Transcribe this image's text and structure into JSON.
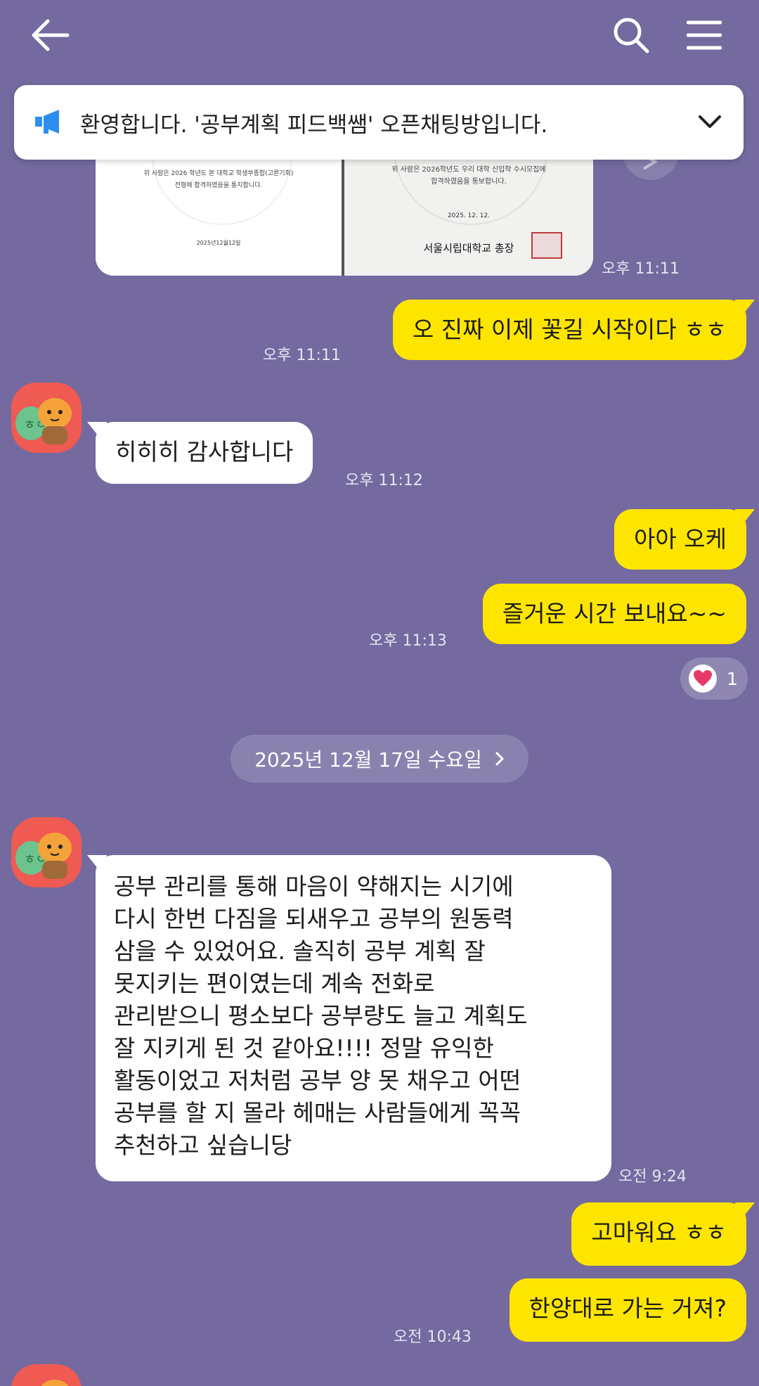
{
  "notice": {
    "text": "환영합니다. '공부계획  피드백쌤' 오픈채팅방입니다."
  },
  "shared_image": {
    "doc1_line1": "위 사람은 2026 학년도 본 대학교  학생부종합(고른기회)",
    "doc1_line2": "전형에 합격하였음을 통지합니다.",
    "doc1_date": "2025년12월12일",
    "doc2_line1": "위 사람은 2026학년도 우리 대학 신입학 수시모집에",
    "doc2_line2": "합격하였음을 통보합니다.",
    "doc2_date": "2025. 12. 12.",
    "doc2_sign": "서울시립대학교 총장",
    "time": "오후 11:11"
  },
  "messages": [
    {
      "sender": "me",
      "text": "오 진짜 이제 꽃길 시작이다 ㅎㅎ",
      "time": "오후 11:11"
    },
    {
      "sender": "other",
      "text": "히히히 감사합니다",
      "time": "오후 11:12"
    },
    {
      "sender": "me",
      "text": "아아 오케"
    },
    {
      "sender": "me",
      "text": "즐거운 시간 보내요~~",
      "time": "오후 11:13",
      "reaction_count": "1"
    },
    {
      "sender": "other",
      "lines": [
        "공부 관리를 통해 마음이 약해지는 시기에",
        "다시 한번 다짐을 되새우고 공부의 원동력",
        "삼을 수 있었어요. 솔직히 공부 계획 잘",
        "못지키는 편이였는데 계속 전화로",
        "관리받으니 평소보다 공부량도 늘고 계획도",
        "잘 지키게 된 것 같아요!!!! 정말 유익한",
        "활동이었고 저처럼 공부 양 못 채우고 어떤",
        "공부를 할 지 몰라 헤매는 사람들에게 꼭꼭",
        "추천하고 싶습니당"
      ],
      "time": "오전 9:24"
    },
    {
      "sender": "me",
      "text": "고마워요 ㅎㅎ"
    },
    {
      "sender": "me",
      "text": "한양대로 가는 거져?",
      "time": "오전 10:43"
    }
  ],
  "date_divider": {
    "text": "2025년 12월 17일 수요일"
  },
  "avatar": {
    "badge_text": "ㅎㅇ"
  },
  "colors": {
    "background": "#746a9f",
    "my_bubble": "#fee500",
    "their_bubble": "#ffffff",
    "notice_icon": "#2e8ef0",
    "heart": "#e8386a",
    "avatar_bg": "#ef5a52"
  },
  "icons": [
    "back-arrow-icon",
    "search-icon",
    "menu-icon",
    "megaphone-icon",
    "chevron-down-icon",
    "share-icon",
    "heart-icon",
    "chevron-right-icon"
  ]
}
